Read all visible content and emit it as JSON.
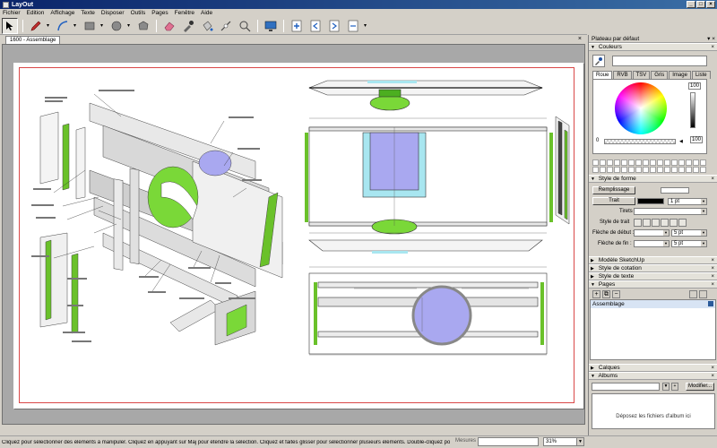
{
  "window": {
    "title": "LayOut",
    "minimize": "_",
    "maximize": "□",
    "close": "×"
  },
  "menu": [
    "Fichier",
    "Edition",
    "Affichage",
    "Texte",
    "Disposer",
    "Outils",
    "Pages",
    "Fenêtre",
    "Aide"
  ],
  "toolbar": {
    "tools": [
      "select-arrow-icon",
      "pencil-icon",
      "arc-icon",
      "rectangle-icon",
      "circle-icon",
      "polygon-icon",
      "eraser-icon",
      "style-eyedropper-icon",
      "paint-bucket-icon",
      "split-icon",
      "join-icon",
      "presentation-icon",
      "add-page-icon",
      "previous-page-icon",
      "next-page-icon",
      "insert-page-icon"
    ]
  },
  "doc": {
    "tab_label": "1600 - Assemblage",
    "close": "×"
  },
  "status": {
    "message": "Cliquez pour sélectionner des éléments à manipuler. Cliquez en appuyant sur Maj pour étendre la sélection. Cliquez et faites glisser pour sélectionner plusieurs éléments. Double-cliquez pour ouvrir l'éditeur.",
    "measure_label": "Mesures",
    "measure_value": "",
    "zoom": "31%"
  },
  "tray": {
    "title": "Plateau par défaut",
    "colors": {
      "header": "Couleurs",
      "tabs": [
        "Roue",
        "RVB",
        "TSV",
        "Gris",
        "Image",
        "Liste"
      ],
      "active_tab": "Roue",
      "brightness_top": "100",
      "brightness_bottom": "100",
      "opacity_label": "0"
    },
    "shape_style": {
      "header": "Style de forme",
      "fill_label": "Remplissage",
      "stroke_label": "Trait",
      "stroke_weight": "1 pt",
      "dashes_label": "Tirets",
      "line_style_label": "Style de trait",
      "start_arrow_label": "Flèche de début :",
      "start_arrow_size": "5 pt",
      "end_arrow_label": "Flèche de fin :",
      "end_arrow_size": "5 pt"
    },
    "collapsed_panels": [
      "Modèle SketchUp",
      "Style de cotation",
      "Style de texte"
    ],
    "pages": {
      "header": "Pages",
      "items": [
        "Assemblage"
      ]
    },
    "layers_header": "Calques",
    "albums": {
      "header": "Albums",
      "modify_button": "Modifier...",
      "drop_hint": "Déposez les fichiers d'album ici"
    }
  },
  "colors": {
    "titlebar": "#0a246a",
    "page_border": "#d94848",
    "accent_green": "#6ac12a",
    "accent_purple": "#a9a8f0",
    "accent_cyan": "#a8e6f0"
  }
}
